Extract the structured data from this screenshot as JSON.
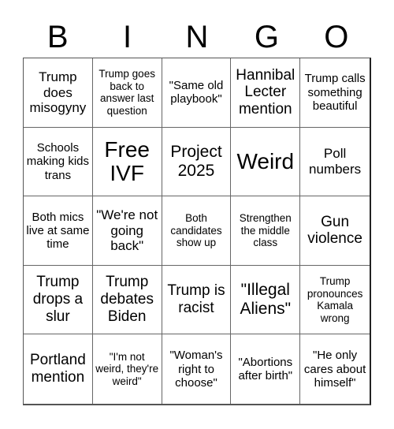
{
  "title_letters": [
    "B",
    "I",
    "N",
    "G",
    "O"
  ],
  "cells": [
    [
      "Trump does misogyny",
      "Trump goes back to answer last question",
      "\"Same old playbook\"",
      "Hannibal Lecter mention",
      "Trump calls something beautiful"
    ],
    [
      "Schools making kids trans",
      "Free IVF",
      "Project 2025",
      "Weird",
      "Poll numbers"
    ],
    [
      "Both mics live at same time",
      "\"We're not going back\"",
      "Both candidates show up",
      "Strengthen the middle class",
      "Gun violence"
    ],
    [
      "Trump drops a slur",
      "Trump debates Biden",
      "Trump is racist",
      "\"Illegal Aliens\"",
      "Trump pronounces Kamala wrong"
    ],
    [
      "Portland mention",
      "\"I'm not weird, they're weird\"",
      "\"Woman's right to choose\"",
      "\"Abortions after birth\"",
      "\"He only cares about himself\""
    ]
  ]
}
